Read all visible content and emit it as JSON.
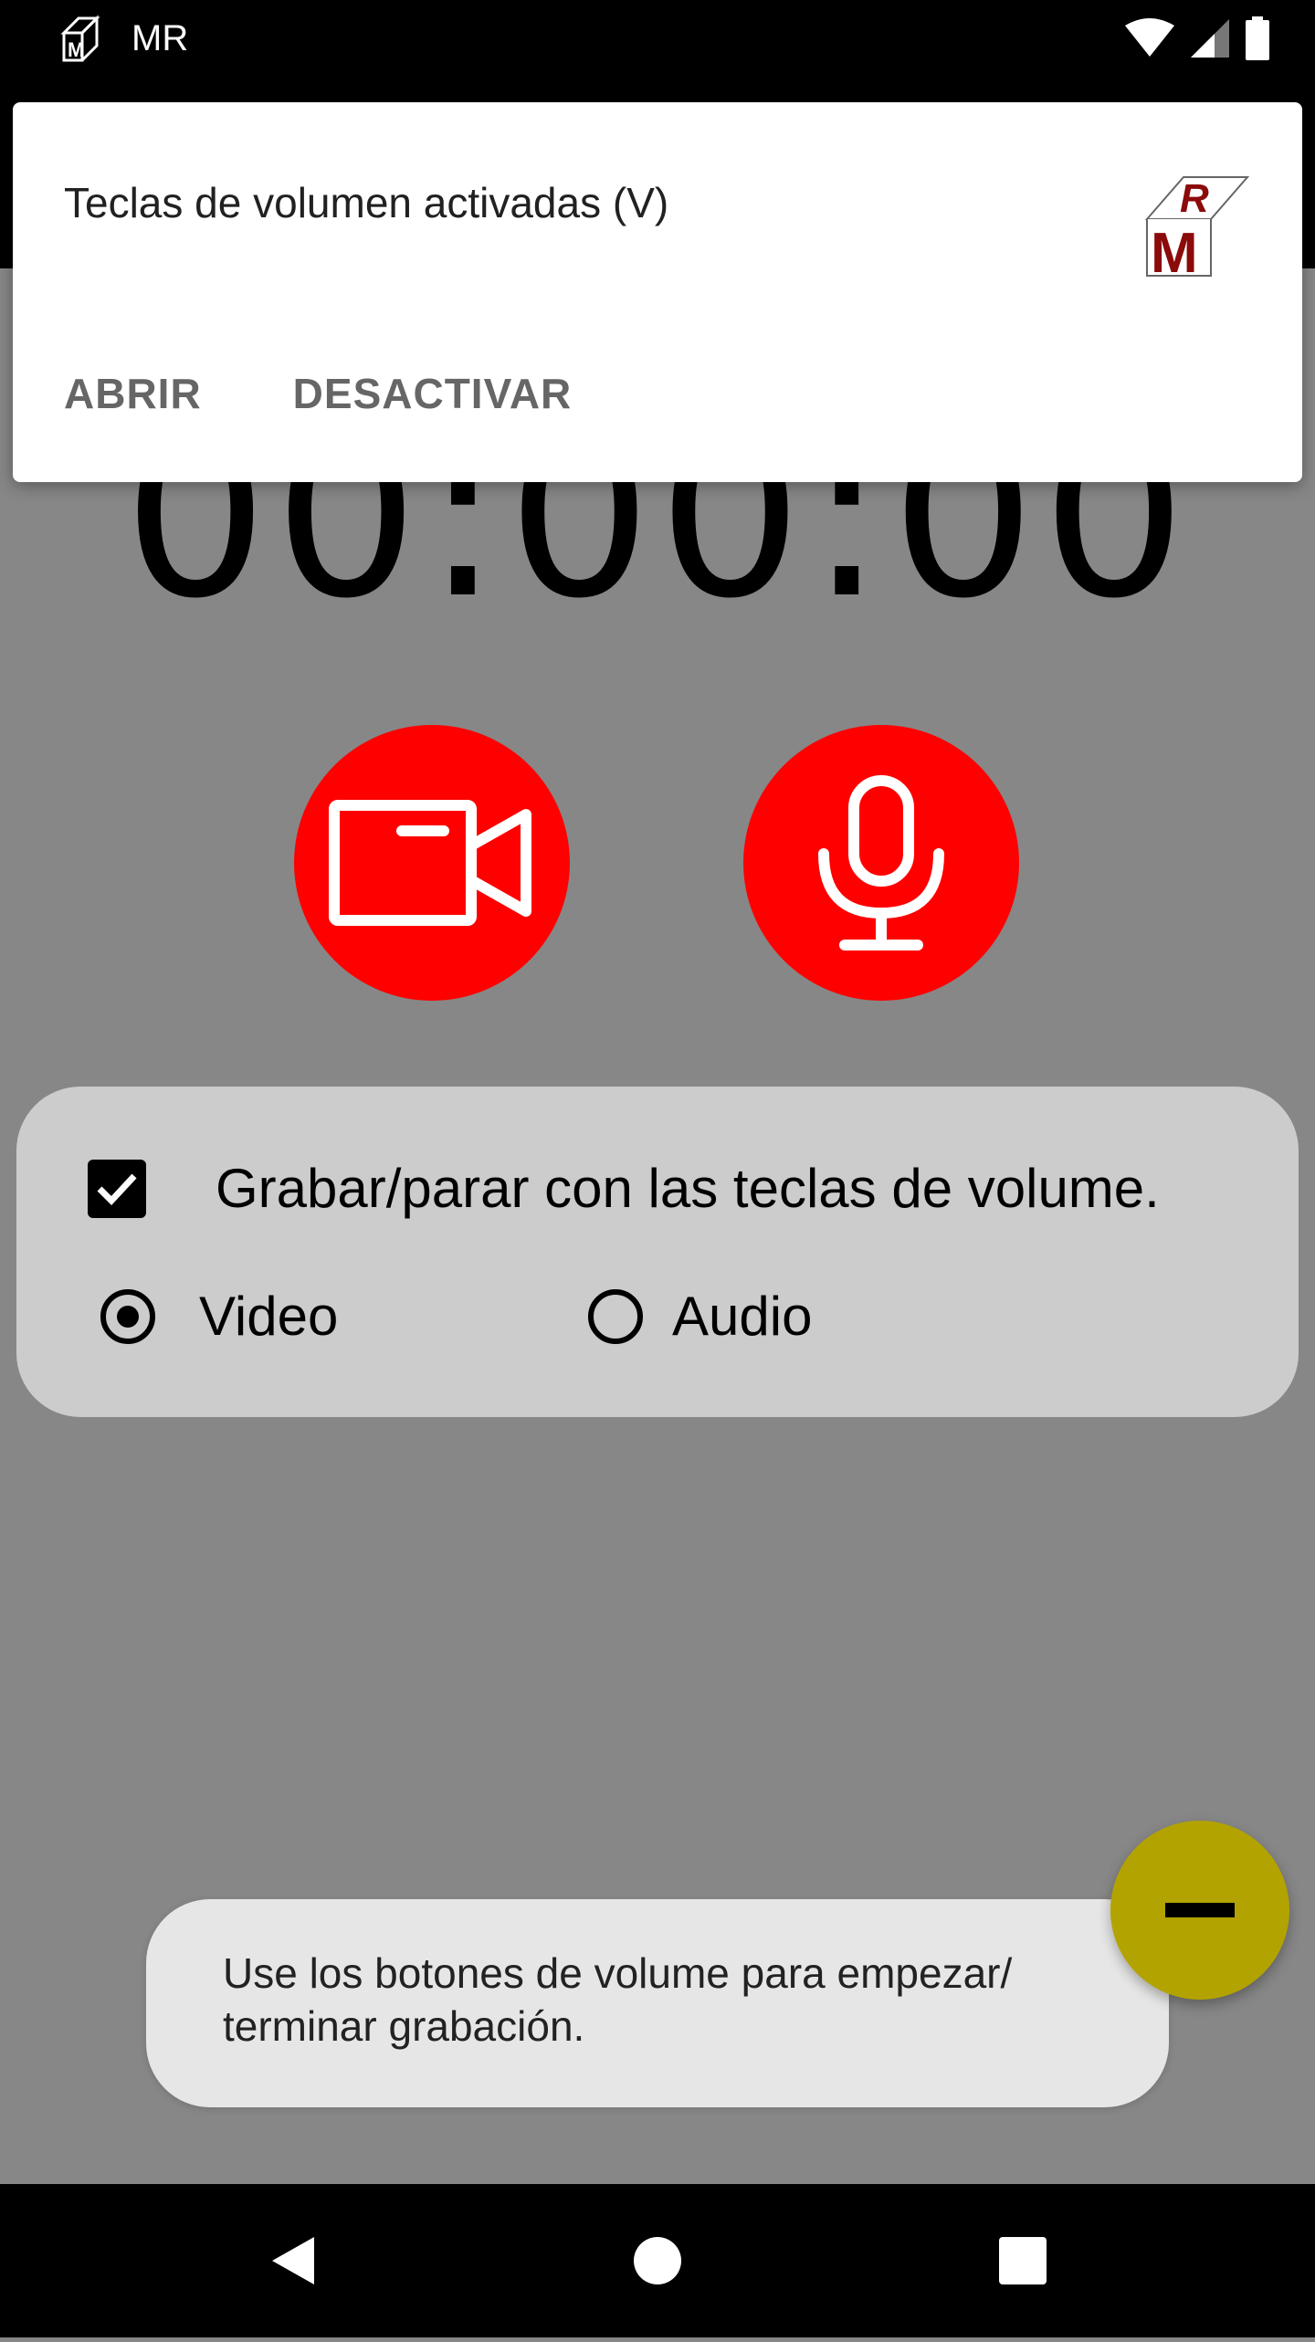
{
  "status_bar": {
    "title": "MR",
    "icons": [
      "app-logo-icon",
      "wifi-icon",
      "signal-icon",
      "battery-icon"
    ]
  },
  "timer": {
    "value": "00:00:00"
  },
  "notification": {
    "text": "Teclas de volumen activadas (V)",
    "open_label": "ABRIR",
    "disable_label": "DESACTIVAR",
    "logo_letters": "RM"
  },
  "buttons": {
    "video_icon": "video-camera-icon",
    "audio_icon": "microphone-icon"
  },
  "options": {
    "checkbox_label": "Grabar/parar con las teclas de volume.",
    "checkbox_checked": true,
    "radio_video_label": "Video",
    "radio_audio_label": "Audio",
    "selected": "Video"
  },
  "toast": {
    "message": "Use los botones de volume para empezar/ terminar grabación."
  },
  "fab": {
    "icon": "minus-icon"
  },
  "navbar": {
    "icons": [
      "back-icon",
      "home-icon",
      "recents-icon"
    ]
  },
  "colors": {
    "record_red": "#ff0000",
    "fab_yellow": "#b3a300",
    "background": "#878787",
    "panel": "#cccccc"
  }
}
